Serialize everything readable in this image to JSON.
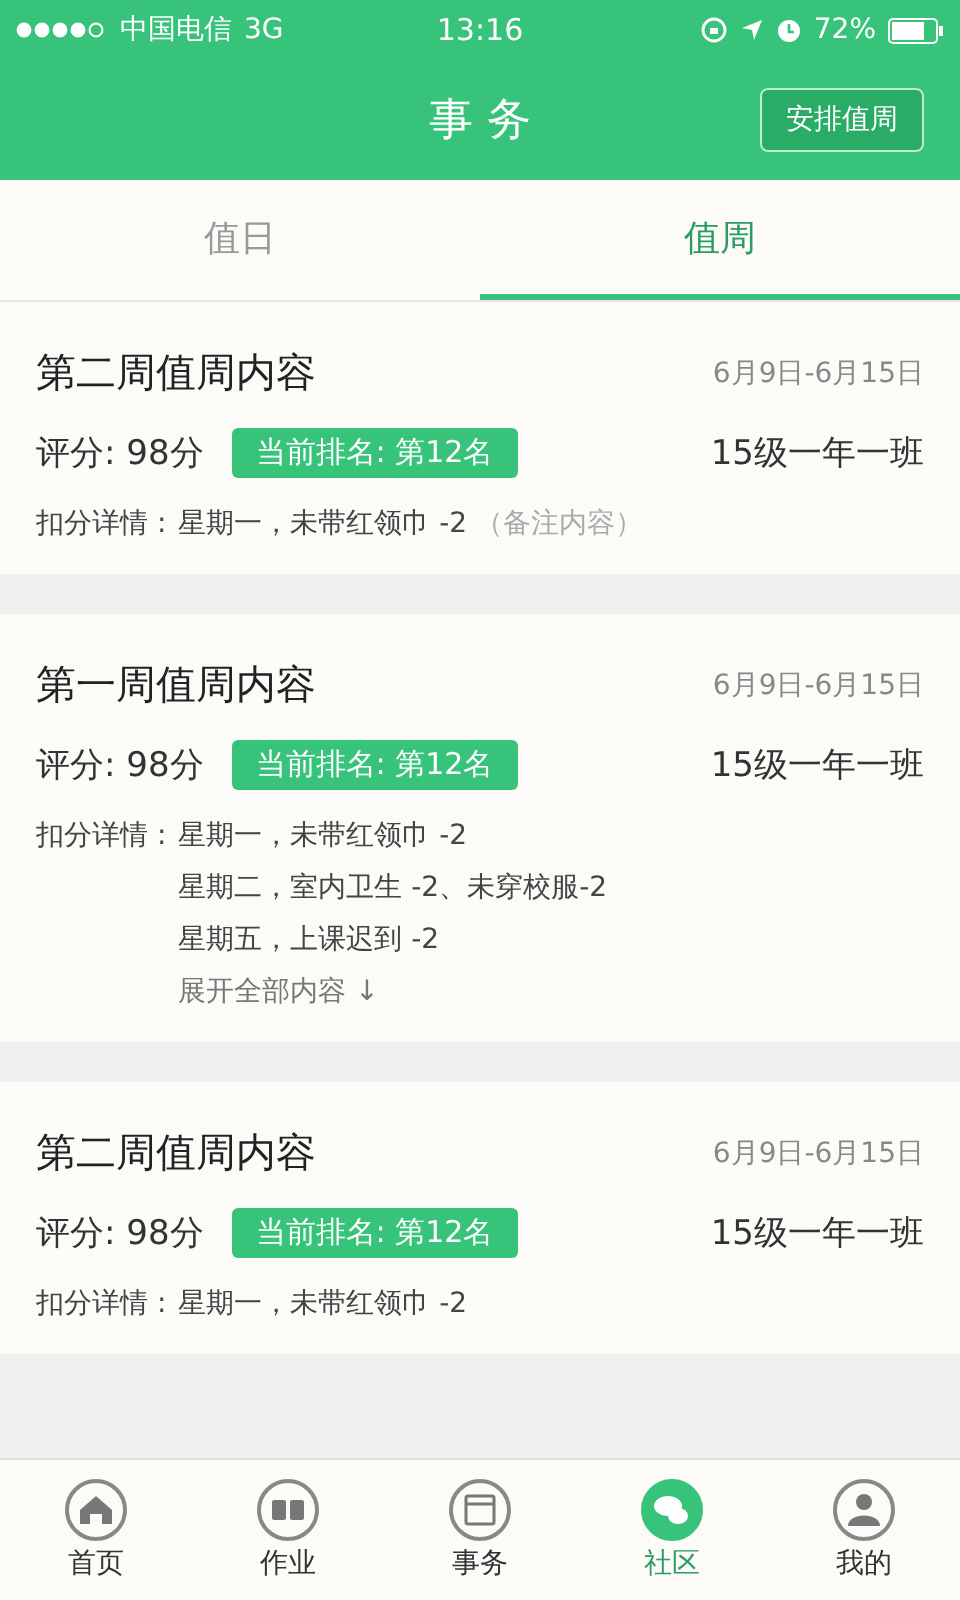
{
  "status_bar": {
    "carrier": "中国电信",
    "network": "3G",
    "time": "13:16",
    "battery": "72%"
  },
  "header": {
    "title": "事 务",
    "action": "安排值周"
  },
  "tabs": [
    {
      "label": "值日",
      "selected": false
    },
    {
      "label": "值周",
      "selected": true
    }
  ],
  "cards": [
    {
      "title": "第二周值周内容",
      "date": "6月9日-6月15日",
      "score": "评分: 98分",
      "rank": "当前排名: 第12名",
      "class_name": "15级一年一班",
      "deduction_label": "扣分详情 :",
      "deductions": [
        "星期一，未带红领巾 -2"
      ],
      "note": "（备注内容）"
    },
    {
      "title": "第一周值周内容",
      "date": "6月9日-6月15日",
      "score": "评分: 98分",
      "rank": "当前排名: 第12名",
      "class_name": "15级一年一班",
      "deduction_label": "扣分详情 :",
      "deductions": [
        "星期一，未带红领巾 -2",
        "星期二，室内卫生 -2、未穿校服-2",
        "星期五，上课迟到 -2"
      ],
      "expand": "展开全部内容 ↓"
    },
    {
      "title": "第二周值周内容",
      "date": "6月9日-6月15日",
      "score": "评分: 98分",
      "rank": "当前排名: 第12名",
      "class_name": "15级一年一班",
      "deduction_label": "扣分详情 :",
      "deductions": [
        "星期一，未带红领巾 -2"
      ]
    }
  ],
  "nav": [
    {
      "kind": "home",
      "label": "首页",
      "selected": false
    },
    {
      "kind": "book",
      "label": "作业",
      "selected": false
    },
    {
      "kind": "calendar",
      "label": "事务",
      "selected": false
    },
    {
      "kind": "chat",
      "label": "社区",
      "selected": true
    },
    {
      "kind": "person",
      "label": "我的",
      "selected": false
    }
  ]
}
